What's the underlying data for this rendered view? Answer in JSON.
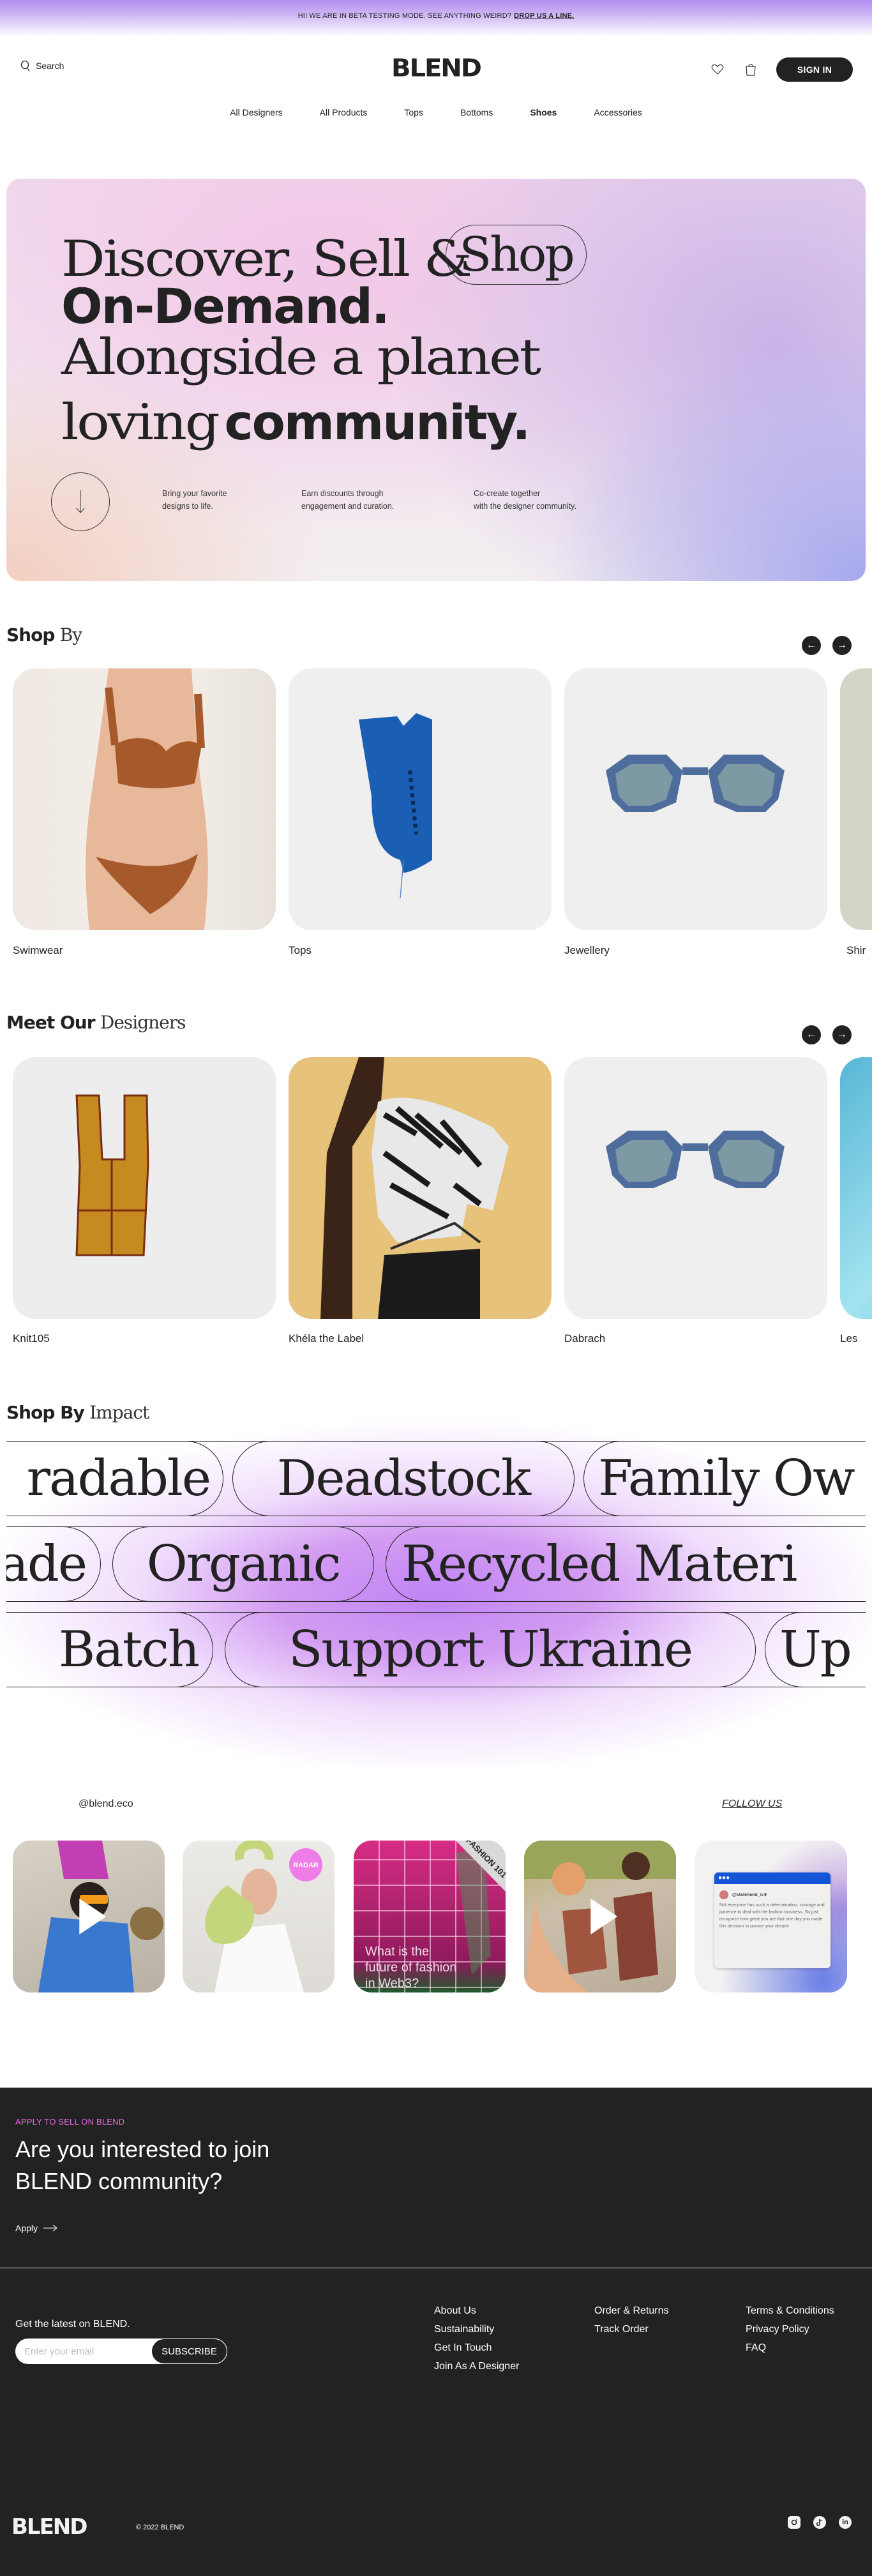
{
  "announcement": {
    "text": "HI! WE ARE IN BETA TESTING MODE. SEE ANYTHING WEIRD?",
    "link": "DROP US A LINE."
  },
  "header": {
    "search_label": "Search",
    "logo": "BLEND",
    "wishlist_icon": "heart-icon",
    "cart_icon": "shopping-bag-icon",
    "signin_label": "SIGN IN"
  },
  "nav": {
    "items": [
      {
        "label": "All Designers"
      },
      {
        "label": "All Products"
      },
      {
        "label": "Tops"
      },
      {
        "label": "Bottoms"
      },
      {
        "label": "Shoes",
        "active": true
      },
      {
        "label": "Accessories"
      }
    ]
  },
  "hero": {
    "line1_serif": "Discover, Sell &",
    "line1_pill": "Shop",
    "line2_bold": "On-Demand.",
    "line3_serif": "Alongside a planet",
    "line4_serif": "loving",
    "line4_bold": "community.",
    "features": [
      {
        "line1": "Bring your favorite",
        "line2": "designs to life."
      },
      {
        "line1": "Earn discounts through",
        "line2": "engagement and curation."
      },
      {
        "line1": "Co-create together",
        "line2": "with the designer community."
      }
    ]
  },
  "shop_by": {
    "title_bold": "Shop",
    "title_serif": "By",
    "prev_label": "←",
    "next_label": "→",
    "items": [
      {
        "label": "Swimwear"
      },
      {
        "label": "Tops"
      },
      {
        "label": "Jewellery"
      },
      {
        "label": "Shir"
      }
    ]
  },
  "designers": {
    "title_bold": "Meet Our",
    "title_serif": "Designers",
    "prev_label": "←",
    "next_label": "→",
    "items": [
      {
        "label": "Knit105"
      },
      {
        "label": "Khéla the Label"
      },
      {
        "label": "Dabrach"
      },
      {
        "label": "Les"
      }
    ]
  },
  "impact": {
    "title_bold": "Shop By",
    "title_serif": "Impact",
    "rows": [
      [
        "radable",
        "Deadstock",
        "Family Ow"
      ],
      [
        "ade",
        "Organic",
        "Recycled Materi"
      ],
      [
        "Batch",
        "Support Ukraine",
        "Up"
      ]
    ]
  },
  "instagram": {
    "handle": "@blend.eco",
    "follow_label": "FOLLOW US",
    "posts": [
      {
        "type": "video"
      },
      {
        "type": "image",
        "badge": "RADAR"
      },
      {
        "type": "image",
        "ribbon": "FASHION 101",
        "caption": "What is the future of fashion in Web3?"
      },
      {
        "type": "video"
      },
      {
        "type": "quote",
        "user": "@statement_n.9",
        "quote": "Not everyone has such a determination, courage and patience to deal with the fashion business. So just recognize how great you are that one day you made this decision to pursue your dream!"
      }
    ]
  },
  "footer": {
    "apply_kicker": "APPLY TO SELL ON BLEND",
    "apply_title_1": "Are you interested to join",
    "apply_title_2": "BLEND community?",
    "apply_link": "Apply",
    "newsletter_label": "Get the latest on BLEND.",
    "email_placeholder": "Enter your email",
    "subscribe_label": "SUBSCRIBE",
    "col1": [
      "About Us",
      "Sustainability",
      "Get In Touch",
      "Join As A Designer"
    ],
    "col2": [
      "Order & Returns",
      "Track Order"
    ],
    "col3": [
      "Terms & Conditions",
      "Privacy Policy",
      "FAQ"
    ],
    "logo": "BLEND",
    "copyright": "© 2022 BLEND",
    "socials": [
      "instagram-icon",
      "tiktok-icon",
      "linkedin-icon"
    ]
  },
  "colors": {
    "dark": "#222222",
    "accent_pink": "#ea6de8",
    "impact_purple": "#c084f5",
    "card_bg": "#efefef"
  }
}
